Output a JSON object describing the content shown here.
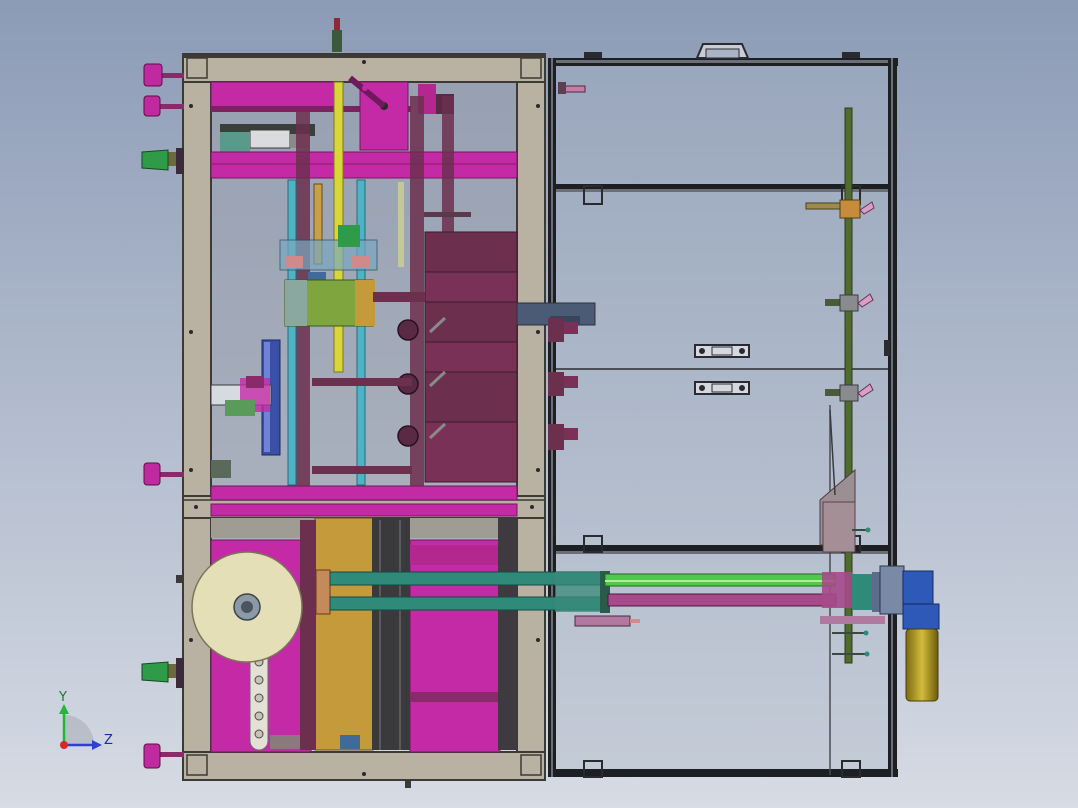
{
  "viewport": {
    "background_top": "#8c9bb6",
    "background_bottom": "#d6dbe4"
  },
  "colors": {
    "frame_tan": "#b9b2a2",
    "frame_edge": "#3c3a35",
    "magenta": "#c42aa6",
    "magenta_dark": "#7b2260",
    "plum": "#6c2f4e",
    "cyan_rod": "#4fb3c6",
    "yellow_rod": "#d8d63a",
    "olive": "#8c8b3a",
    "green_block": "#7ea53e",
    "teal": "#2f8a7a",
    "green_cyl": "#53c64c",
    "orange_plate": "#c59a3a",
    "roll_cream": "#e4dfb6",
    "motor_blue": "#2f59b8",
    "motor_gold": "#b19a25",
    "dark_rod": "#4f6b30",
    "knob_magenta": "#c02aa0",
    "knob_green": "#2f9a47",
    "glass": "#aab4c4"
  },
  "triad": {
    "y_label": "Y",
    "z_label": "Z",
    "y_color": "#27b33d",
    "z_color": "#2f3fd6",
    "x_color": "#d62828"
  }
}
